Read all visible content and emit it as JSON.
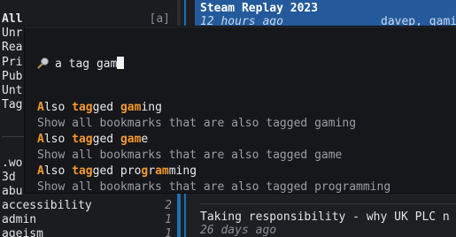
{
  "sidebar": {
    "filter_all": "All",
    "filter_all_key": "[a]",
    "filters": [
      "Unr",
      "Rea",
      "Pri",
      "Pub",
      "Unt",
      "Tag"
    ],
    "tags_top": ".wo",
    "tags_second": "3d",
    "tags_third": "abu",
    "tags": [
      {
        "name": "accessibility",
        "count": "2"
      },
      {
        "name": "admin",
        "count": "1"
      },
      {
        "name": "ageism",
        "count": "1"
      }
    ]
  },
  "main": {
    "top_card": {
      "title": "Steam Replay 2023",
      "time": "12 hours ago",
      "tags": "davep, gamin"
    },
    "bottom_card": {
      "title": "Taking responsibility - why UK PLC n",
      "time": "26 days ago"
    }
  },
  "palette": {
    "query": "a tag gam",
    "results": [
      {
        "parts": [
          {
            "text": "A",
            "hl": true
          },
          {
            "text": "lso ",
            "hl": false
          },
          {
            "text": "tag",
            "hl": true
          },
          {
            "text": "ged ",
            "hl": false
          },
          {
            "text": "gam",
            "hl": true
          },
          {
            "text": "ing",
            "hl": false
          }
        ],
        "description": "Show all bookmarks that are also tagged gaming"
      },
      {
        "parts": [
          {
            "text": "A",
            "hl": true
          },
          {
            "text": "lso ",
            "hl": false
          },
          {
            "text": "tag",
            "hl": true
          },
          {
            "text": "ged ",
            "hl": false
          },
          {
            "text": "gam",
            "hl": true
          },
          {
            "text": "e",
            "hl": false
          }
        ],
        "description": "Show all bookmarks that are also tagged game"
      },
      {
        "parts": [
          {
            "text": "A",
            "hl": true
          },
          {
            "text": "lso ",
            "hl": false
          },
          {
            "text": "tag",
            "hl": true
          },
          {
            "text": "ged pro",
            "hl": false
          },
          {
            "text": "g",
            "hl": true
          },
          {
            "text": "r",
            "hl": false
          },
          {
            "text": "am",
            "hl": true
          },
          {
            "text": "ming",
            "hl": false
          }
        ],
        "description": "Show all bookmarks that are also tagged programming"
      }
    ]
  },
  "colors": {
    "accent": "#1f6fb6",
    "highlight": "#f39a2b",
    "selected_card": "#245a9c"
  },
  "icons": {
    "search": "magnifying-glass-icon"
  }
}
